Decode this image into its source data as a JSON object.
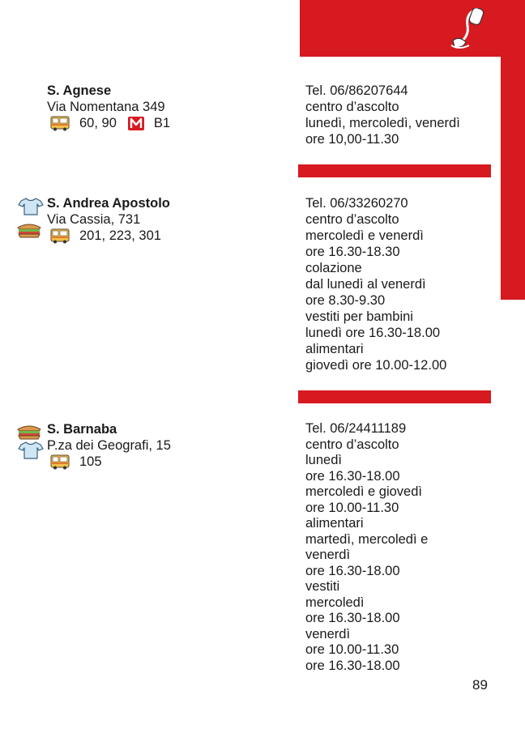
{
  "accent": "#d71920",
  "header": {
    "icon": "telephone-icon"
  },
  "entries": [
    {
      "name": "S. Agnese",
      "address": "Via Nomentana 349",
      "bus": "60, 90",
      "metro": "B1",
      "services_icons": [],
      "info": [
        "Tel. 06/86207644",
        "centro d’ascolto",
        "lunedì, mercoledì, venerdì",
        "ore 10,00-11.30"
      ]
    },
    {
      "name": "S. Andrea Apostolo",
      "address": "Via Cassia, 731",
      "bus": "201, 223, 301",
      "services_icons": [
        "clothing-icon",
        "sandwich-icon"
      ],
      "info": [
        "Tel. 06/33260270",
        "centro d’ascolto",
        "mercoledì e venerdì",
        "ore 16.30-18.30",
        "colazione",
        "dal lunedì al venerdì",
        "ore 8.30-9.30",
        "vestiti per bambini",
        "lunedì ore 16.30-18.00",
        "alimentari",
        "giovedì ore 10.00-12.00"
      ]
    },
    {
      "name": "S. Barnaba",
      "address": "P.za dei Geografi, 15",
      "bus": "105",
      "services_icons": [
        "sandwich-icon",
        "clothing-icon"
      ],
      "info": [
        "Tel. 06/24411189",
        "centro d’ascolto",
        "lunedì",
        "ore 16.30-18.00",
        "mercoledì e giovedì",
        "ore 10.00-11.30",
        "alimentari",
        "martedì, mercoledì e",
        "venerdì",
        "ore 16.30-18.00",
        "vestiti",
        "mercoledì",
        "ore 16.30-18.00",
        "venerdì",
        "ore 10.00-11.30",
        "ore 16.30-18.00"
      ]
    }
  ],
  "page_number": "89"
}
